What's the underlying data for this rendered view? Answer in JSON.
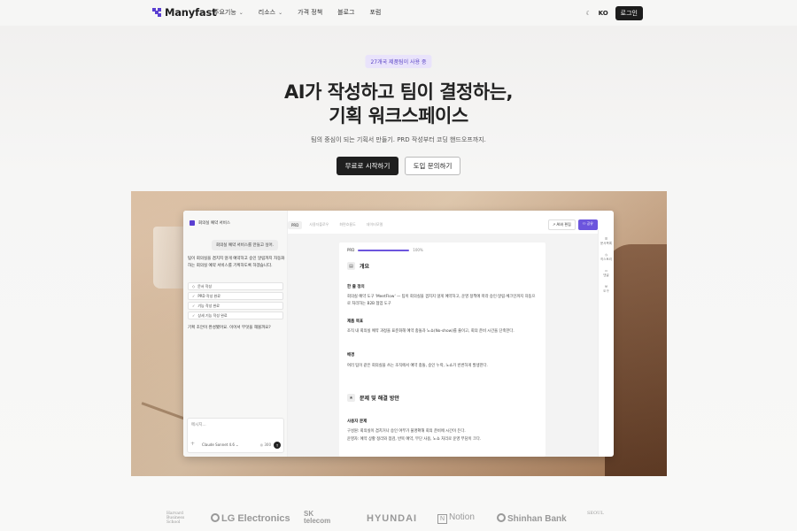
{
  "nav": {
    "brand": "Manyfast",
    "links": [
      {
        "label": "주요기능",
        "dropdown": true
      },
      {
        "label": "리소스",
        "dropdown": true
      },
      {
        "label": "가격 정책",
        "dropdown": false
      },
      {
        "label": "블로그",
        "dropdown": false
      },
      {
        "label": "포럼",
        "dropdown": false
      }
    ],
    "language": "KO",
    "login_label": "로그인"
  },
  "hero": {
    "badge": "27개국 제품팀이 사용 중",
    "headline_line1": "AI가 작성하고 팀이 결정하는,",
    "headline_line2": "기획 워크스페이스",
    "subline": "팀의 중심이 되는 기획서 만들기. PRD 작성부터 코딩 핸드오프까지.",
    "cta_primary": "무료로 시작하기",
    "cta_secondary": "도입 문의하기"
  },
  "app": {
    "chat_title": "회의실 예약 서비스",
    "user_message": "회의실 예약 서비스를 만들고 싶어.",
    "ai_message": "팀이 회의실을 겹치지 않게 예약하고 승인 알림까지 자동화하는 회의실 예약 서비스를 기획하도록 하겠습니다.",
    "steps": [
      {
        "label": "문서 작성",
        "icon": "◇"
      },
      {
        "label": "PRD 작성 완료",
        "icon": "✓"
      },
      {
        "label": "기능 작성 완료",
        "icon": "✓"
      },
      {
        "label": "상세 기능 작성 완료",
        "icon": "✓"
      }
    ],
    "ai_question": "기획 초안이 완성됐어요. 이어서 무엇을 해볼까요?",
    "input_placeholder": "메시지...",
    "model": "Claude Sonnet 4.6",
    "count": "300",
    "doc_tabs": [
      "PRD",
      "사용자플로우",
      "화면흐름도",
      "데이터모델"
    ],
    "ai_edit_label": "AI와 편집",
    "share_label": "공유",
    "rail_items": [
      "문서목록",
      "히스토리",
      "댓글",
      "도구"
    ],
    "progress_label": "PRD",
    "progress_value": 100,
    "progress_text": "100%",
    "section1_title": "개요",
    "h_oneliner": "한 줄 정의",
    "p_oneliner": "회의실 예약 도구 'MeetFlow' — 팀이 회의실을 겹치지 않게 예약하고, 운영 정책에 따라 승인·알림·체크인까지 자동으로 처리하는 B2B 협업 도구",
    "h_goal": "제품 목표",
    "p_goal": "조직 내 회의실 예약 과정을 표준화해 예약 충돌과 노쇼(No-show)를 줄이고, 회의 준비 시간을 단축한다.",
    "h_background": "배경",
    "p_background": "여러 팀이 같은 회의실을 쓰는 조직에서 예약 충돌, 승인 누락, 노쇼가 빈번하게 발생한다.",
    "section2_title": "문제 및 해결 방안",
    "h_user_problem": "사용자 문제",
    "p_user_problem_1": "구성원: 회의실이 겹치거나 승인 여부가 불명확해 회의 준비에 시간이 든다.",
    "p_user_problem_2": "운영자: 예약 상황 정리와 점검, 반복 예약, 무단 사용, 노쇼 처리로 운영 부담이 크다."
  },
  "partners": [
    "Harvard Business School",
    "LG Electronics",
    "SK telecom",
    "HYUNDAI",
    "Notion",
    "Shinhan Bank",
    "SEOUL"
  ],
  "colors": {
    "accent": "#6c55dd",
    "badge_bg": "#e9e3fb",
    "dark": "#1c1c1c"
  }
}
